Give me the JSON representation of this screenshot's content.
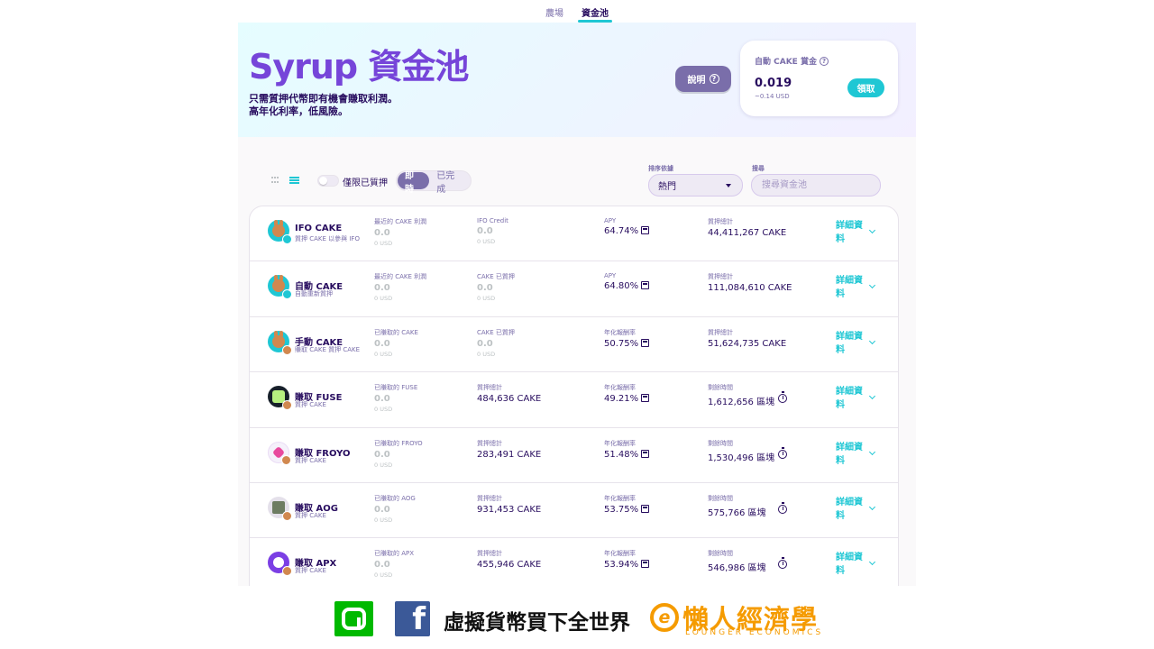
{
  "nav": {
    "tabs": [
      "農場",
      "資金池"
    ],
    "active": 1
  },
  "hero": {
    "title": "Syrup 資金池",
    "line1": "只需質押代幣即有機會賺取利潤。",
    "line2": "高年化利率，低風險。",
    "help_label": "說明",
    "bounty_label": "自動 CAKE 賞金",
    "bounty_value": "0.019",
    "bounty_usd": "~0.14 USD",
    "claim_label": "領取"
  },
  "controls": {
    "staked_only_label": "僅限已質押",
    "seg_live": "即時",
    "seg_finished": "已完成",
    "sort_label": "排序依據",
    "sort_value": "熱門",
    "search_label": "搜尋",
    "search_placeholder": "搜尋資金池"
  },
  "colors": {
    "primary": "#1fc7d4",
    "secondary": "#7645d9",
    "text": "#280d5f",
    "sub": "#7a6eaa"
  },
  "pools": [
    {
      "icon": "cake-icon",
      "name": "IFO CAKE",
      "sub": "質押 CAKE 以參與 IFO",
      "c1_label": "最近的 CAKE 利潤",
      "c1_val": "0.0",
      "c1_usd": "0 USD",
      "c2_label": "IFO Credit",
      "c2_val": "0.0",
      "c2_usd": "0 USD",
      "c3_label": "APY",
      "c3_val": "64.74%",
      "c4_label": "質押總計",
      "c4_val": "44,411,267 CAKE",
      "details": "詳細資料"
    },
    {
      "icon": "cake-icon",
      "name": "自動 CAKE",
      "sub": "自動重新質押",
      "c1_label": "最近的 CAKE 利潤",
      "c1_val": "0.0",
      "c1_usd": "0 USD",
      "c2_label": "CAKE 已質押",
      "c2_val": "0.0",
      "c2_usd": "0 USD",
      "c3_label": "APY",
      "c3_val": "64.80%",
      "c4_label": "質押總計",
      "c4_val": "111,084,610 CAKE",
      "details": "詳細資料"
    },
    {
      "icon": "cake-icon",
      "name": "手動 CAKE",
      "sub": "賺取 CAKE 質押 CAKE",
      "c1_label": "已賺取的 CAKE",
      "c1_val": "0.0",
      "c1_usd": "0 USD",
      "c2_label": "CAKE 已質押",
      "c2_val": "0.0",
      "c2_usd": "0 USD",
      "c3_label": "年化報酬率",
      "c3_val": "50.75%",
      "c4_label": "質押總計",
      "c4_val": "51,624,735 CAKE",
      "details": "詳細資料"
    },
    {
      "icon": "fuse-icon",
      "name": "賺取 FUSE",
      "sub": "質押 CAKE",
      "c1_label": "已賺取的 FUSE",
      "c1_val": "0.0",
      "c1_usd": "0 USD",
      "c2_label": "質押總計",
      "c2_val": "484,636 CAKE",
      "c3_label": "年化報酬率",
      "c3_val": "49.21%",
      "c4_label": "剩餘時間",
      "c4_val": "1,612,656 區塊",
      "details": "詳細資料"
    },
    {
      "icon": "froyo-icon",
      "name": "賺取 FROYO",
      "sub": "質押 CAKE",
      "c1_label": "已賺取的 FROYO",
      "c1_val": "0.0",
      "c1_usd": "0 USD",
      "c2_label": "質押總計",
      "c2_val": "283,491 CAKE",
      "c3_label": "年化報酬率",
      "c3_val": "51.48%",
      "c4_label": "剩餘時間",
      "c4_val": "1,530,496 區塊",
      "details": "詳細資料"
    },
    {
      "icon": "aog-icon",
      "name": "賺取 AOG",
      "sub": "質押 CAKE",
      "c1_label": "已賺取的 AOG",
      "c1_val": "0.0",
      "c1_usd": "0 USD",
      "c2_label": "質押總計",
      "c2_val": "931,453 CAKE",
      "c3_label": "年化報酬率",
      "c3_val": "53.75%",
      "c4_label": "剩餘時間",
      "c4_val": "575,766 區塊",
      "details": "詳細資料"
    },
    {
      "icon": "apx-icon",
      "name": "賺取 APX",
      "sub": "質押 CAKE",
      "c1_label": "已賺取的 APX",
      "c1_val": "0.0",
      "c1_usd": "0 USD",
      "c2_label": "質押總計",
      "c2_val": "455,946 CAKE",
      "c3_label": "年化報酬率",
      "c3_val": "53.94%",
      "c4_label": "剩餘時間",
      "c4_val": "546,986 區塊",
      "details": "詳細資料"
    }
  ],
  "footer": {
    "slogan": "虛擬貨幣買下全世界",
    "logo_letter": "e",
    "brand": "懶人經濟學",
    "brand_en": "LOUNGER ECONOMICS"
  }
}
